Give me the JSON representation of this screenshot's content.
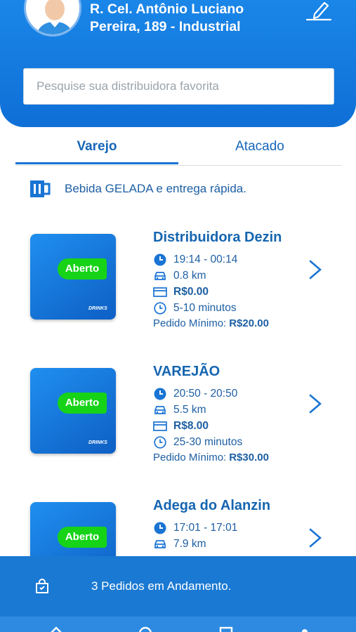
{
  "header": {
    "address_line1": "R. Cel. Antônio Luciano",
    "address_line2": "Pereira, 189 - Industrial",
    "edit_icon": "pencil-icon"
  },
  "search": {
    "placeholder": "Pesquise sua distribuidora favorita",
    "value": ""
  },
  "tabs": [
    {
      "label": "Varejo",
      "active": true
    },
    {
      "label": "Atacado",
      "active": false
    }
  ],
  "promo": {
    "icon": "beer-mug-icon",
    "text": "Bebida GELADA e entrega rápida."
  },
  "stores": [
    {
      "name": "Distribuidora Dezin",
      "status": "Aberto",
      "hours": "19:14 - 00:14",
      "distance": "0.8 km",
      "fee": "R$0.00",
      "time": "5-10 minutos",
      "min_label": "Pedido Mínimo:",
      "min_value": "R$20.00"
    },
    {
      "name": "VAREJÃO",
      "status": "Aberto",
      "hours": "20:50 - 20:50",
      "distance": "5.5 km",
      "fee": "R$8.00",
      "time": "25-30 minutos",
      "min_label": "Pedido Mínimo:",
      "min_value": "R$30.00"
    },
    {
      "name": "Adega do Alanzin",
      "status": "Aberto",
      "hours": "17:01 - 17:01",
      "distance": "7.9 km"
    }
  ],
  "logo_text": "DRINKS",
  "orders_bar": {
    "icon": "shopping-bag-icon",
    "text": "3 Pedidos em Andamento."
  },
  "colors": {
    "primary": "#1a79d2",
    "open_badge": "#16d318",
    "text_blue": "#1565b0"
  }
}
